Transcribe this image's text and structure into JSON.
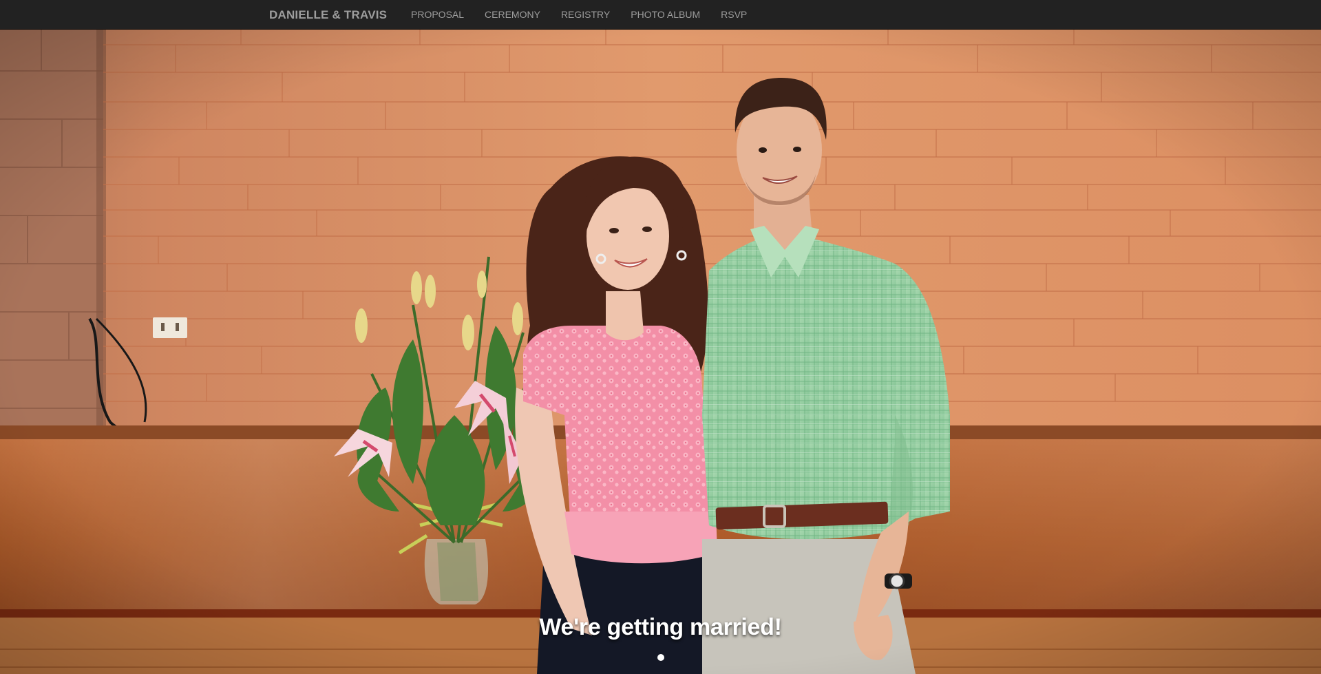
{
  "navbar": {
    "brand": "DANIELLE & TRAVIS",
    "links": [
      {
        "label": "PROPOSAL"
      },
      {
        "label": "CEREMONY"
      },
      {
        "label": "REGISTRY"
      },
      {
        "label": "PHOTO ALBUM"
      },
      {
        "label": "RSVP"
      }
    ]
  },
  "hero": {
    "caption": "We're getting married!",
    "slide_count": 1,
    "active_slide": 1
  },
  "colors": {
    "navbar_bg": "#222222",
    "nav_text": "#9d9d9d",
    "wall": "#d9895c",
    "stage": "#b65e2a",
    "caption": "#ffffff"
  }
}
